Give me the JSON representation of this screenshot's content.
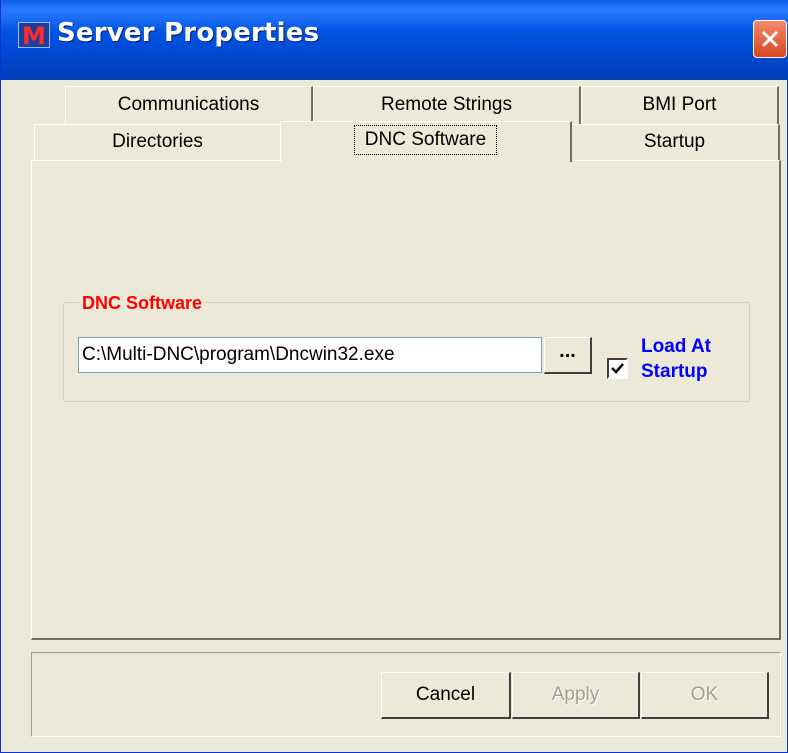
{
  "window": {
    "title": "Server Properties",
    "app_icon_glyph": "M"
  },
  "tabs": {
    "row1": [
      "Communications",
      "Remote Strings",
      "BMI Port"
    ],
    "row2": [
      "Directories",
      "DNC Software",
      "Startup"
    ],
    "active": "DNC Software"
  },
  "dnc": {
    "group_title": "DNC Software",
    "path_value": "C:\\Multi-DNC\\program\\Dncwin32.exe",
    "browse_label": "...",
    "load_at_startup_label_line1": "Load At",
    "load_at_startup_label_line2": "Startup",
    "load_at_startup_checked": true
  },
  "buttons": {
    "cancel": "Cancel",
    "apply": "Apply",
    "ok": "OK"
  },
  "colors": {
    "titlebar": "#0054e3",
    "dialog_bg": "#ece9d8",
    "group_title": "#ff0000",
    "checkbox_label": "#0000ff",
    "close_button": "#d9461f"
  }
}
